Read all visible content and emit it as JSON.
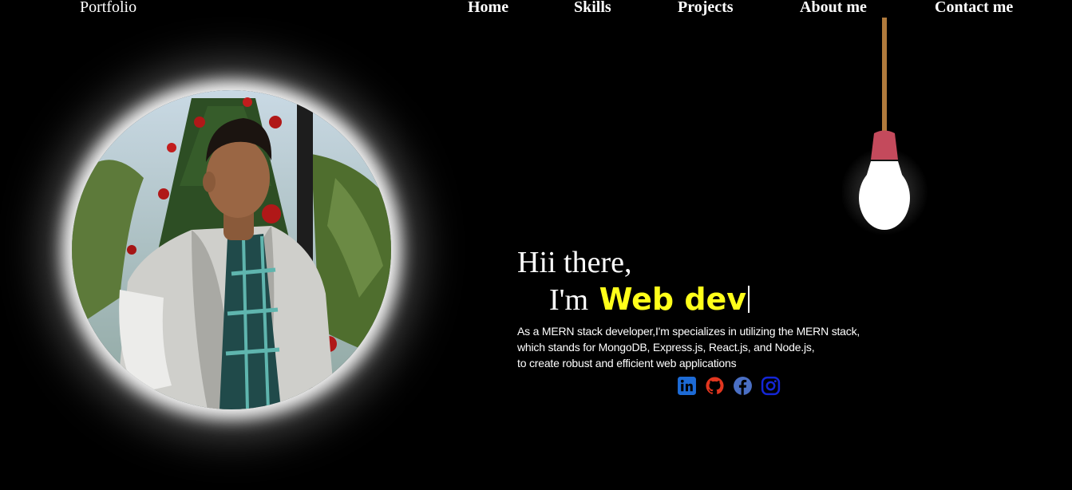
{
  "nav": {
    "brand": "Portfolio",
    "items": [
      {
        "label": "Home"
      },
      {
        "label": "Skills"
      },
      {
        "label": "Projects"
      },
      {
        "label": "About me"
      },
      {
        "label": "Contact me"
      }
    ]
  },
  "hero": {
    "greeting": "Hii there,",
    "im_prefix": "I'm",
    "role_typed": "Web dev",
    "description_lines": [
      "As a MERN stack developer,I'm specializes in utilizing the MERN stack,",
      "which stands for MongoDB, Express.js, React.js, and Node.js,",
      "to create robust and efficient web applications"
    ]
  },
  "socials": [
    {
      "icon": "linkedin-icon",
      "color": "#1d6bd6"
    },
    {
      "icon": "github-icon",
      "color": "#e2361f"
    },
    {
      "icon": "facebook-icon",
      "color": "#4a6fc4"
    },
    {
      "icon": "instagram-icon",
      "color": "#1426d6"
    }
  ],
  "colors": {
    "background": "#000000",
    "accent": "#ffff1a",
    "text": "#ffffff"
  }
}
